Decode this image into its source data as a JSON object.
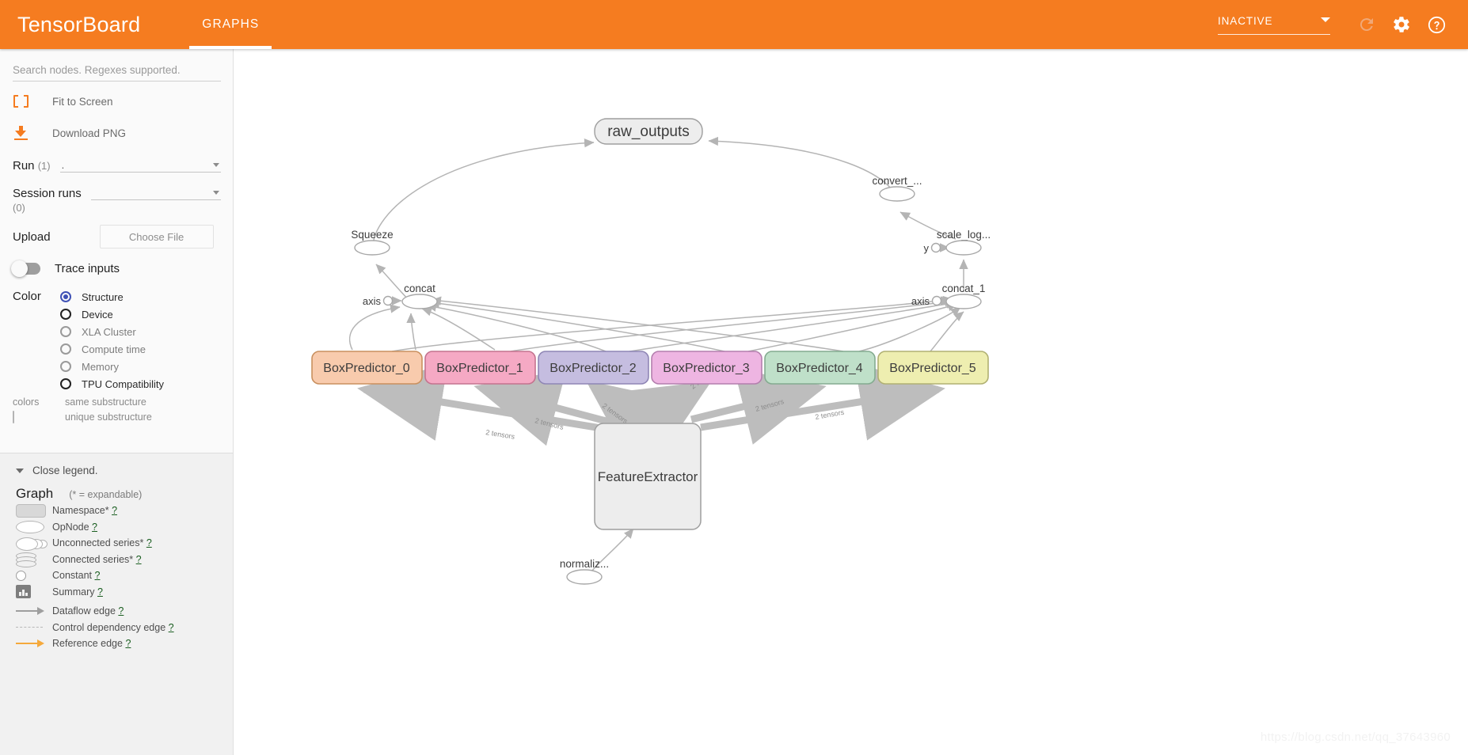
{
  "app": {
    "brand": "TensorBoard",
    "tabs": [
      {
        "label": "GRAPHS",
        "active": true
      }
    ],
    "run_status": "INACTIVE",
    "icons": [
      "refresh-icon",
      "gear-icon",
      "help-icon",
      "chevron-down-icon"
    ]
  },
  "sidebar": {
    "search": {
      "placeholder": "Search nodes. Regexes supported.",
      "value": ""
    },
    "fit_to_screen": "Fit to Screen",
    "download_png": "Download PNG",
    "run": {
      "label": "Run",
      "count": "(1)",
      "value": "."
    },
    "session_runs": {
      "label": "Session runs",
      "count": "(0)",
      "value": ""
    },
    "upload": {
      "label": "Upload",
      "button": "Choose File"
    },
    "trace_inputs": {
      "label": "Trace inputs",
      "on": false
    },
    "color": {
      "label": "Color",
      "options": [
        {
          "label": "Structure",
          "state": "selected"
        },
        {
          "label": "Device",
          "state": "dark"
        },
        {
          "label": "XLA Cluster",
          "state": "normal"
        },
        {
          "label": "Compute time",
          "state": "normal"
        },
        {
          "label": "Memory",
          "state": "normal"
        },
        {
          "label": "TPU Compatibility",
          "state": "dark"
        }
      ],
      "swatch_key": "colors",
      "same_substructure": "same substructure",
      "unique_substructure": "unique substructure"
    }
  },
  "legend": {
    "close": "Close legend.",
    "title": "Graph",
    "hint": "(* = expandable)",
    "items": [
      {
        "icon": "namespace-icon",
        "label": "Namespace*",
        "help": "?"
      },
      {
        "icon": "opnode-icon",
        "label": "OpNode",
        "help": "?"
      },
      {
        "icon": "unconnected-series-icon",
        "label": "Unconnected series*",
        "help": "?"
      },
      {
        "icon": "connected-series-icon",
        "label": "Connected series*",
        "help": "?"
      },
      {
        "icon": "constant-icon",
        "label": "Constant",
        "help": "?"
      },
      {
        "icon": "summary-icon",
        "label": "Summary",
        "help": "?"
      },
      {
        "icon": "dataflow-edge-icon",
        "label": "Dataflow edge",
        "help": "?"
      },
      {
        "icon": "control-dependency-edge-icon",
        "label": "Control dependency edge",
        "help": "?"
      },
      {
        "icon": "reference-edge-icon",
        "label": "Reference edge",
        "help": "?"
      }
    ]
  },
  "graph": {
    "watermark": "https://blog.csdn.net/qq_37643960",
    "nodes": {
      "raw_outputs": "raw_outputs",
      "squeeze": "Squeeze",
      "concat": "concat",
      "concat_axis": "axis",
      "convert": "convert_...",
      "scale_log": "scale_log...",
      "y": "y",
      "concat_1": "concat_1",
      "concat_1_axis": "axis",
      "feature_extractor": "FeatureExtractor",
      "normalize": "normaliz..."
    },
    "box_predictors": [
      {
        "label": "BoxPredictor_0",
        "fill": "#f8cbad",
        "stroke": "#c9905f"
      },
      {
        "label": "BoxPredictor_1",
        "fill": "#f5a9c4",
        "stroke": "#c4738f"
      },
      {
        "label": "BoxPredictor_2",
        "fill": "#c5bde0",
        "stroke": "#8f86b5"
      },
      {
        "label": "BoxPredictor_3",
        "fill": "#eeb5e2",
        "stroke": "#b47fae"
      },
      {
        "label": "BoxPredictor_4",
        "fill": "#bfe0c9",
        "stroke": "#84ab90"
      },
      {
        "label": "BoxPredictor_5",
        "fill": "#eeeeb0",
        "stroke": "#b0b072"
      }
    ],
    "edge_labels": [
      "2 tensors",
      "2 tensors",
      "2 tensors",
      "2 tensors",
      "2 tensors",
      "2 tensors"
    ]
  },
  "colors": {
    "brand_orange": "#f57c20",
    "accent_indigo": "#3f51b5",
    "edge_gray": "#b0b0b0",
    "namespace_fill": "#ededed"
  }
}
